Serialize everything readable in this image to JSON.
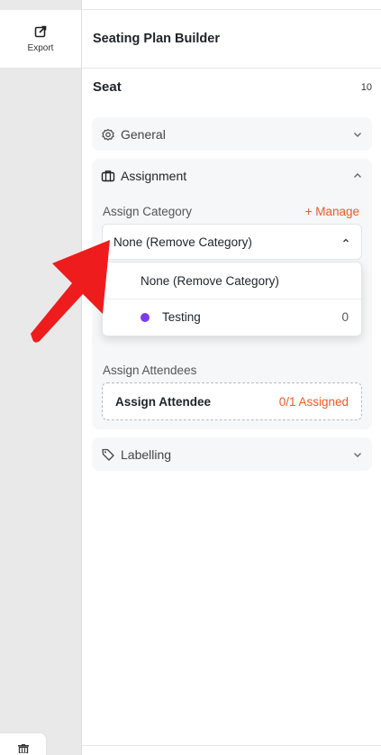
{
  "rail": {
    "export_label": "Export"
  },
  "header": {
    "title": "Seating Plan Builder"
  },
  "seat": {
    "label": "Seat",
    "count": "10"
  },
  "sections": {
    "general": {
      "title": "General"
    },
    "assignment": {
      "title": "Assignment",
      "category_label": "Assign Category",
      "manage_label": "+ Manage",
      "selected_value": "None (Remove Category)",
      "options": [
        {
          "name": "None (Remove Category)"
        },
        {
          "name": "Testing",
          "count": "0",
          "color": "#7c3aed"
        }
      ],
      "attendees_label": "Assign Attendees",
      "assign_button_label": "Assign Attendee",
      "assigned_status": "0/1 Assigned"
    },
    "labelling": {
      "title": "Labelling"
    }
  },
  "colors": {
    "accent": "#ef5a24",
    "annotation_arrow": "#ee1c1c",
    "category_testing": "#7c3aed"
  }
}
